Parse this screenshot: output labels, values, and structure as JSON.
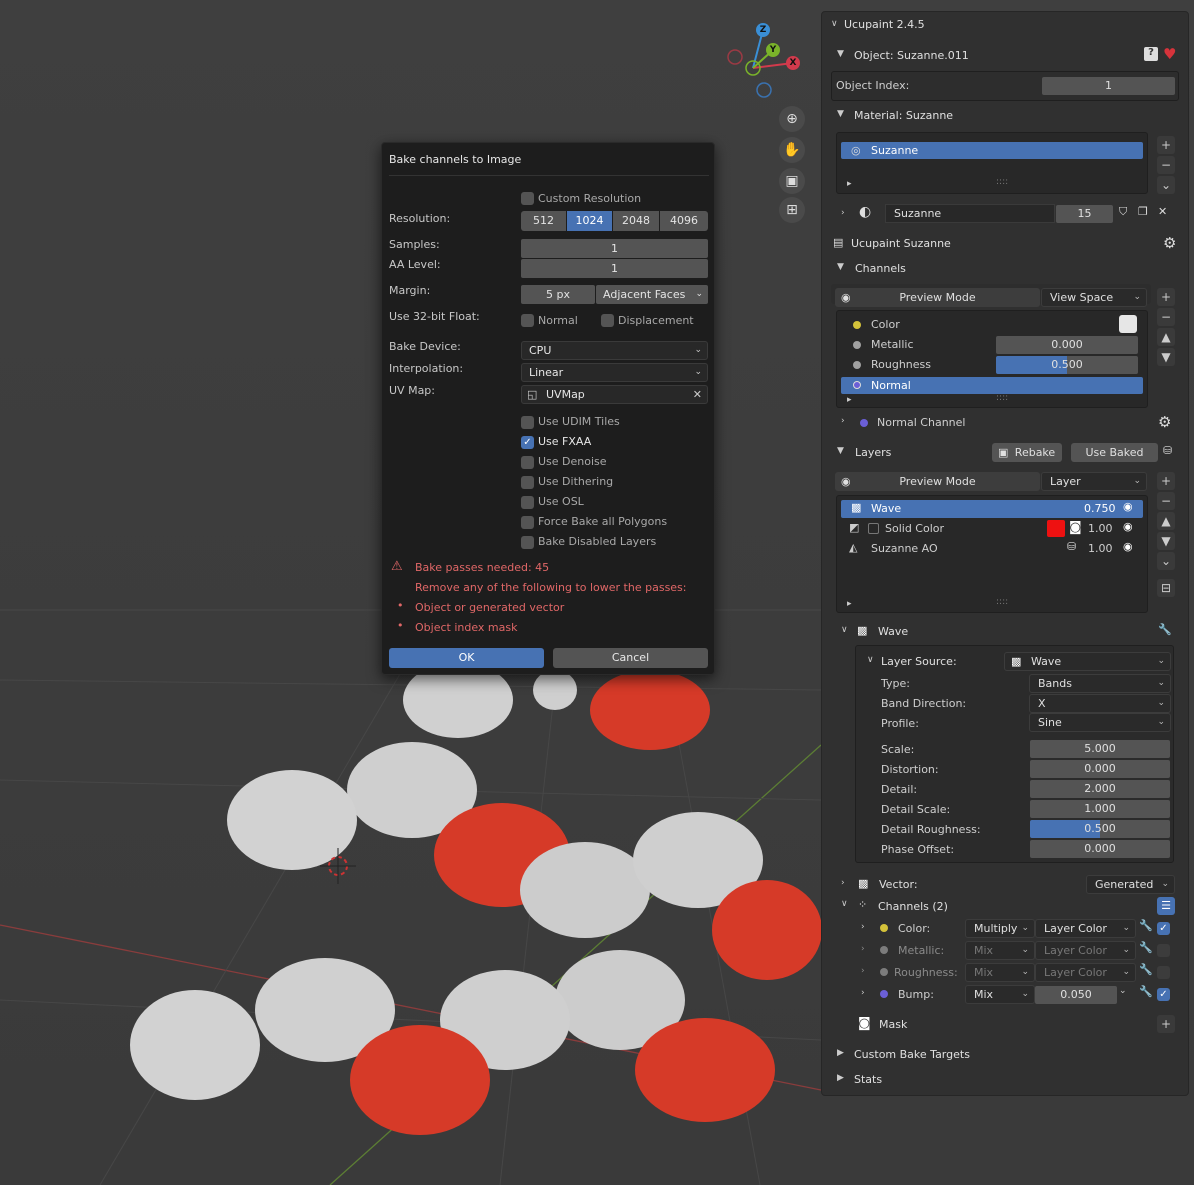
{
  "dialog": {
    "title": "Bake channels to Image",
    "custom_resolution": "Custom Resolution",
    "resolution_label": "Resolution:",
    "resolution_options": [
      "512",
      "1024",
      "2048",
      "4096"
    ],
    "samples_label": "Samples:",
    "samples": "1",
    "aa_label": "AA Level:",
    "aa": "1",
    "margin_label": "Margin:",
    "margin": "5 px",
    "margin_type": "Adjacent Faces",
    "float_label": "Use 32-bit Float:",
    "float_normal": "Normal",
    "float_disp": "Displacement",
    "device_label": "Bake Device:",
    "device": "CPU",
    "interp_label": "Interpolation:",
    "interp": "Linear",
    "uv_label": "UV Map:",
    "uv": "UVMap",
    "options": [
      {
        "label": "Use UDIM Tiles",
        "checked": false
      },
      {
        "label": "Use FXAA",
        "checked": true
      },
      {
        "label": "Use Denoise",
        "checked": false
      },
      {
        "label": "Use Dithering",
        "checked": false
      },
      {
        "label": "Use OSL",
        "checked": false
      },
      {
        "label": "Force Bake all Polygons",
        "checked": false
      },
      {
        "label": "Bake Disabled Layers",
        "checked": false
      }
    ],
    "warn1": "Bake passes needed: 45",
    "warn2": "Remove any of the following to lower the passes:",
    "warn3": "Object or generated vector",
    "warn4": "Object index mask",
    "ok": "OK",
    "cancel": "Cancel"
  },
  "panel": {
    "header": "Ucupaint 2.4.5",
    "object": "Object: Suzanne.011",
    "object_index_label": "Object Index:",
    "object_index": "1",
    "material": "Material: Suzanne",
    "material_slot": "Suzanne",
    "mat_name": "Suzanne",
    "mat_users": "15",
    "ucupaint_tree": "Ucupaint Suzanne",
    "channels_title": "Channels",
    "preview_mode": "Preview Mode",
    "view_space": "View Space",
    "channels": [
      {
        "name": "Color",
        "color": "#d4c23a"
      },
      {
        "name": "Metallic",
        "value": "0.000",
        "color": "#a0a0a0"
      },
      {
        "name": "Roughness",
        "value": "0.500",
        "color": "#a0a0a0"
      },
      {
        "name": "Normal",
        "color": "#6b5fd6"
      }
    ],
    "normal_channel": "Normal Channel",
    "layers_title": "Layers",
    "rebake": "Rebake",
    "use_baked": "Use Baked",
    "layer_preview": "Preview Mode",
    "layer_mode": "Layer",
    "layers": [
      {
        "name": "Wave",
        "value": "0.750"
      },
      {
        "name": "Solid Color",
        "value": "1.00"
      },
      {
        "name": "Suzanne AO",
        "value": "1.00"
      }
    ],
    "wave_title": "Wave",
    "layer_source_label": "Layer Source:",
    "layer_source": "Wave",
    "props": [
      {
        "label": "Type:",
        "value": "Bands"
      },
      {
        "label": "Band Direction:",
        "value": "X"
      },
      {
        "label": "Profile:",
        "value": "Sine"
      }
    ],
    "nums": [
      {
        "label": "Scale:",
        "value": "5.000"
      },
      {
        "label": "Distortion:",
        "value": "0.000"
      },
      {
        "label": "Detail:",
        "value": "2.000"
      },
      {
        "label": "Detail Scale:",
        "value": "1.000"
      },
      {
        "label": "Detail Roughness:",
        "value": "0.500"
      },
      {
        "label": "Phase Offset:",
        "value": "0.000"
      }
    ],
    "vector_label": "Vector:",
    "vector": "Generated",
    "channels2": "Channels (2)",
    "ch_rows": [
      {
        "label": "Color:",
        "blend": "Multiply",
        "src": "Layer Color",
        "color": "#d4c23a"
      },
      {
        "label": "Metallic:",
        "blend": "Mix",
        "src": "Layer Color",
        "color": "#a0a0a0"
      },
      {
        "label": "Roughness:",
        "blend": "Mix",
        "src": "Layer Color",
        "color": "#a0a0a0"
      },
      {
        "label": "Bump:",
        "blend": "Mix",
        "src": "0.050",
        "color": "#6b5fd6"
      }
    ],
    "mask": "Mask",
    "custom_bake": "Custom Bake Targets",
    "stats": "Stats"
  },
  "gizmo": {
    "z": "Z",
    "y": "Y",
    "x": "X"
  }
}
